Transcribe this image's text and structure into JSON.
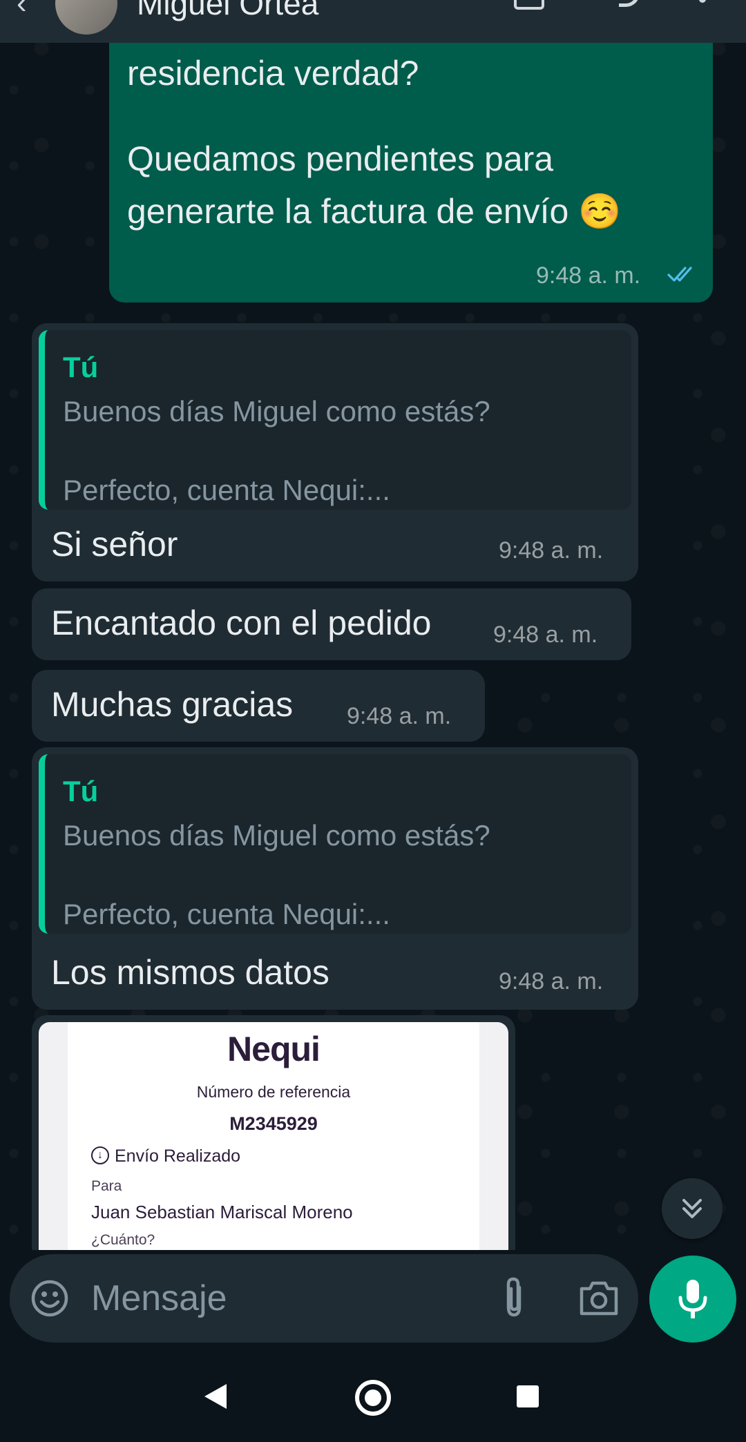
{
  "header": {
    "contact_name": "Miguel Ortea"
  },
  "messages": [
    {
      "id": "m1",
      "direction": "out",
      "lines": [
        "residencia verdad?",
        "",
        "Quedamos pendientes para",
        "generarte la factura de envío ☺️"
      ],
      "time": "9:48 a. m.",
      "status": "read"
    },
    {
      "id": "m2",
      "direction": "in",
      "quote": {
        "author": "Tú",
        "line1": "Buenos días Miguel como estás?",
        "line2": "Perfecto, cuenta Nequi:..."
      },
      "text": "Si señor",
      "time": "9:48 a. m."
    },
    {
      "id": "m3",
      "direction": "in",
      "text": "Encantado con el pedido",
      "time": "9:48 a. m."
    },
    {
      "id": "m4",
      "direction": "in",
      "text": "Muchas gracias",
      "time": "9:48 a. m."
    },
    {
      "id": "m5",
      "direction": "in",
      "quote": {
        "author": "Tú",
        "line1": "Buenos días Miguel como estás?",
        "line2": "Perfecto, cuenta Nequi:..."
      },
      "text": "Los mismos datos",
      "time": "9:48 a. m."
    }
  ],
  "receipt": {
    "logo": "Nequi",
    "ref_label": "Número de referencia",
    "ref_value": "M2345929",
    "status": "Envío Realizado",
    "para_label": "Para",
    "recipient": "Juan Sebastian Mariscal Moreno",
    "cuanto_label": "¿Cuánto?"
  },
  "composer": {
    "placeholder": "Mensaje"
  },
  "colors": {
    "background": "#0b141a",
    "outgoing_bubble": "#005c4b",
    "incoming_bubble": "#202c33",
    "accent": "#00a884",
    "quote_author": "#06cf9c",
    "read_ticks": "#53bdeb"
  },
  "icons": {
    "header": [
      "back-arrow-icon",
      "video-call-icon",
      "voice-call-icon",
      "more-options-icon"
    ],
    "composer": [
      "emoji-icon",
      "attach-icon",
      "camera-icon",
      "mic-icon"
    ],
    "scroll": "double-chevron-down-icon",
    "nav": [
      "nav-back-icon",
      "nav-home-icon",
      "nav-recents-icon"
    ]
  }
}
